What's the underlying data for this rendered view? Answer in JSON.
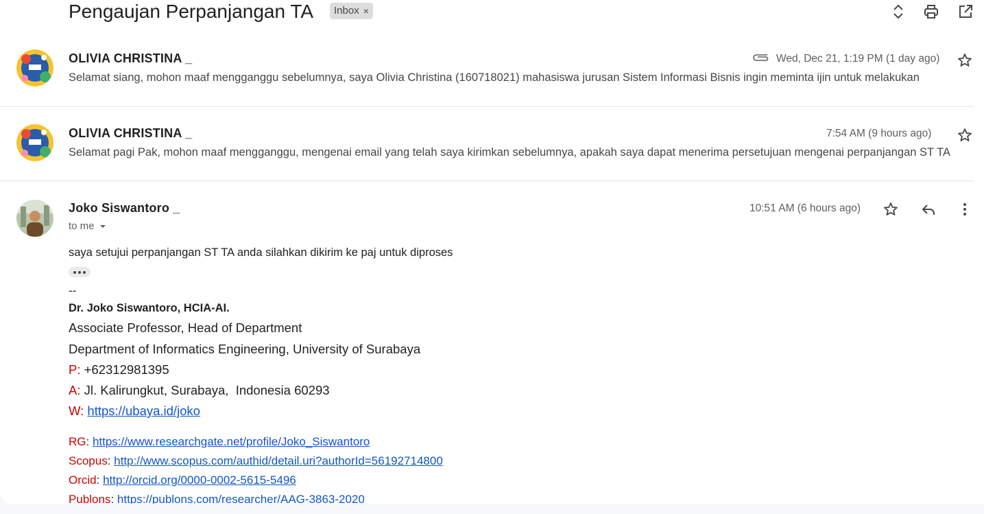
{
  "thread": {
    "subject": "Pengaujan Perpanjangan TA",
    "label": "Inbox",
    "label_remove": "×"
  },
  "header_icons": [
    "expand-collapse-icon",
    "print-icon",
    "open-in-new-window-icon"
  ],
  "messages": [
    {
      "sender": "OLIVIA CHRISTINA _",
      "time": "Wed, Dec 21, 1:19 PM (1 day ago)",
      "has_attachment": true,
      "snippet": "Selamat siang, mohon maaf mengganggu sebelumnya, saya Olivia Christina (160718021) mahasiswa jurusan Sistem Informasi Bisnis ingin meminta ijin untuk melakukan"
    },
    {
      "sender": "OLIVIA CHRISTINA _",
      "time": "7:54 AM (9 hours ago)",
      "has_attachment": false,
      "snippet": "Selamat pagi Pak, mohon maaf mengganggu, mengenai email yang telah saya kirimkan sebelumnya, apakah saya dapat menerima persetujuan mengenai perpanjangan ST TA"
    },
    {
      "sender": "Joko Siswantoro _",
      "time": "10:51 AM (6 hours ago)",
      "recipient": "to me",
      "body": "saya setujui perpanjangan ST TA anda silahkan dikirim ke paj untuk diproses",
      "signature": {
        "separator": "--",
        "name": "Dr. Joko Siswantoro, HCIA-AI.",
        "title": "Associate Professor, Head of Department",
        "department": "Department of Informatics Engineering, University of Surabaya",
        "phone_label": "P:",
        "phone": "+62312981395",
        "address_label": "A:",
        "address": "Jl. Kalirungkut, Surabaya,  Indonesia 60293",
        "web_label": "W:",
        "web": "https://ubaya.id/joko",
        "rg_label": "RG",
        "rg": "https://www.researchgate.net/profile/Joko_Siswantoro",
        "scopus_label": "Scopus",
        "scopus": "http://www.scopus.com/authid/detail.uri?authorId=56192714800",
        "orcid_label": "Orcid",
        "orcid": "http://orcid.org/0000-0002-5615-5496",
        "publons_label": "Publons",
        "publons": "https://publons.com/researcher/AAG-3863-2020"
      }
    }
  ],
  "colors": {
    "sig_key": "#cc0000",
    "link": "#1155cc",
    "chip_bg": "#dddddd"
  }
}
